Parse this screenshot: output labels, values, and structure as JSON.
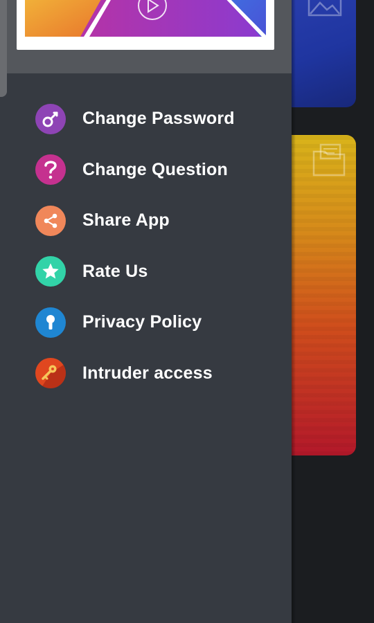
{
  "menu": {
    "items": [
      {
        "label": "Change Password",
        "icon": "key-icon",
        "color": "#8e44b5"
      },
      {
        "label": "Change Question",
        "icon": "question-icon",
        "color": "#c5318f"
      },
      {
        "label": "Share App",
        "icon": "share-icon",
        "color": "#f0875a"
      },
      {
        "label": "Rate Us",
        "icon": "star-icon",
        "color": "#32d3a8"
      },
      {
        "label": "Privacy Policy",
        "icon": "keyhole-icon",
        "color": "#1f86d2"
      },
      {
        "label": "Intruder access",
        "icon": "door-key-icon",
        "color": "#e0471f"
      }
    ]
  },
  "colors": {
    "drawer_bg": "#363a41",
    "header_bg": "#54575c",
    "background_dark": "#1b1d20"
  }
}
